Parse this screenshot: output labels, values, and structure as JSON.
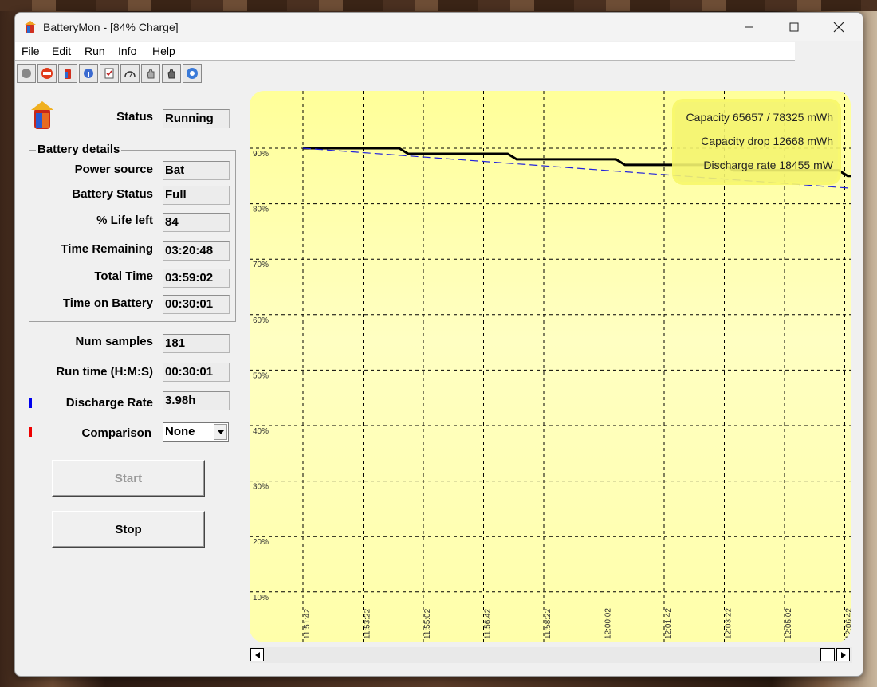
{
  "window": {
    "title": "BatteryMon - [84% Charge]"
  },
  "menu": [
    "File",
    "Edit",
    "Run",
    "Info",
    "Help"
  ],
  "toolbar": [
    "circle-icon",
    "stop-icon",
    "battery-icon",
    "info-icon",
    "checklist-icon",
    "gauge-icon",
    "hand-icon",
    "hand-dark-icon",
    "help-icon"
  ],
  "status": {
    "label": "Status",
    "value": "Running"
  },
  "battery_details": {
    "title": "Battery details",
    "power_source": {
      "label": "Power source",
      "value": "Bat"
    },
    "battery_status": {
      "label": "Battery Status",
      "value": "Full"
    },
    "life_left": {
      "label": "% Life left",
      "value": "84"
    },
    "time_remaining": {
      "label": "Time Remaining",
      "value": "03:20:48"
    },
    "total_time": {
      "label": "Total Time",
      "value": "03:59:02"
    },
    "time_on_battery": {
      "label": "Time on Battery",
      "value": "00:30:01"
    }
  },
  "num_samples": {
    "label": "Num samples",
    "value": "181"
  },
  "run_time": {
    "label": "Run time (H:M:S)",
    "value": "00:30:01"
  },
  "discharge_rate": {
    "label": "Discharge Rate",
    "value": "3.98h",
    "marker_color": "#0000ee"
  },
  "comparison": {
    "label": "Comparison",
    "value": "None",
    "marker_color": "#ee0000"
  },
  "buttons": {
    "start": "Start",
    "stop": "Stop"
  },
  "chart_data": {
    "type": "line",
    "y_ticks": [
      "90%",
      "80%",
      "70%",
      "60%",
      "50%",
      "40%",
      "30%",
      "20%",
      "10%"
    ],
    "x_ticks": [
      "11:51:42",
      "11:53:22",
      "11:55:02",
      "11:56:42",
      "11:58:22",
      "12:00:02",
      "12:01:42",
      "12:03:22",
      "12:05:02",
      "12:06:42"
    ],
    "ylim": [
      10,
      90
    ],
    "grid": true,
    "series": [
      {
        "name": "",
        "color": "#000000",
        "points": [
          [
            0,
            90
          ],
          [
            1.6,
            90
          ],
          [
            1.75,
            89
          ],
          [
            3.4,
            89
          ],
          [
            3.55,
            88
          ],
          [
            5.2,
            88
          ],
          [
            5.35,
            87
          ],
          [
            7.0,
            87
          ],
          [
            7.15,
            86
          ],
          [
            8.9,
            86
          ],
          [
            9.05,
            85
          ],
          [
            10.1,
            85
          ]
        ]
      },
      {
        "name": "",
        "color": "#2222dd",
        "dashed": true,
        "points": [
          [
            0,
            90
          ],
          [
            10.1,
            82
          ]
        ]
      }
    ],
    "info": [
      "Capacity 65657 / 78325 mWh",
      "Capacity drop 12668 mWh",
      "Discharge rate 18455 mW"
    ],
    "info_box_color": "#f4f470"
  }
}
